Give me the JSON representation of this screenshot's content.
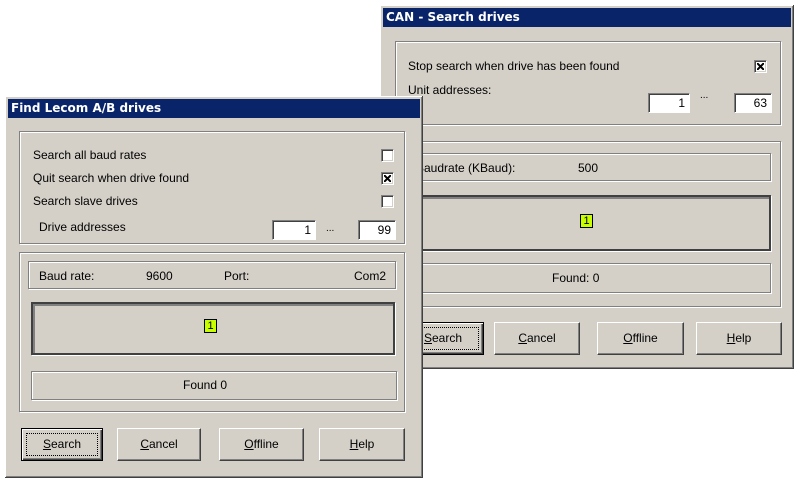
{
  "can_dialog": {
    "title": "CAN - Search drives",
    "stop_search_label": "Stop search when drive has been found",
    "stop_search_checked": true,
    "unit_addresses_label": "Unit addresses:",
    "unit_from": "1",
    "unit_sep": "...",
    "unit_to": "63",
    "baudrate_label": "Baudrate (KBaud):",
    "baudrate_value": "500",
    "indicator": "1",
    "found_text": "Found:  0",
    "buttons": {
      "search": {
        "first": "S",
        "rest": "earch"
      },
      "cancel": {
        "first": "C",
        "rest": "ancel"
      },
      "offline": {
        "first": "O",
        "rest": "ffline"
      },
      "help": {
        "first": "H",
        "rest": "elp"
      }
    }
  },
  "lecom_dialog": {
    "title": "Find Lecom A/B drives",
    "search_all_baud_label": "Search all baud rates",
    "search_all_baud_checked": false,
    "quit_search_label": "Quit search when drive found",
    "quit_search_checked": true,
    "search_slave_label": "Search slave drives",
    "search_slave_checked": false,
    "drive_addresses_label": "Drive addresses",
    "drive_from": "1",
    "drive_sep": "...",
    "drive_to": "99",
    "baud_rate_label": "Baud rate:",
    "baud_rate_value": "9600",
    "port_label": "Port:",
    "port_value": "Com2",
    "indicator": "1",
    "found_text": "Found  0",
    "buttons": {
      "search": {
        "first": "S",
        "rest": "earch"
      },
      "cancel": {
        "first": "C",
        "rest": "ancel"
      },
      "offline": {
        "first": "O",
        "rest": "ffline"
      },
      "help": {
        "first": "H",
        "rest": "elp"
      }
    }
  },
  "colors": {
    "titlebar": "#0a246a",
    "dialog_face": "#d4d0c8",
    "indicator_fill": "#c8ff00"
  }
}
